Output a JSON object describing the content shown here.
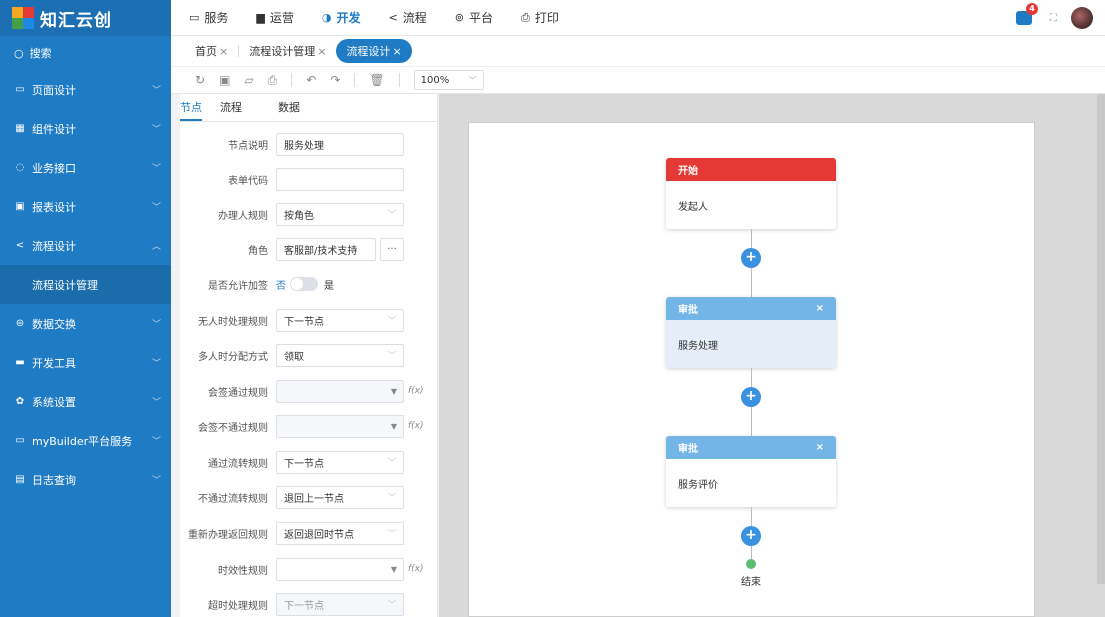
{
  "brand": {
    "name": "知汇云创",
    "colors": {
      "primary": "#1f7bc4",
      "start_node": "#e53935",
      "approve_node": "#73b5e6",
      "end_node": "#5bbd72",
      "badge": "#e53935"
    }
  },
  "sidebar": {
    "search_label": "搜索",
    "items": [
      {
        "label": "页面设计",
        "icon": "page-icon"
      },
      {
        "label": "组件设计",
        "icon": "grid-icon"
      },
      {
        "label": "业务接口",
        "icon": "interface-icon"
      },
      {
        "label": "报表设计",
        "icon": "report-icon"
      },
      {
        "label": "流程设计",
        "icon": "share-icon"
      },
      {
        "label": "数据交换",
        "icon": "database-icon"
      },
      {
        "label": "开发工具",
        "icon": "tools-icon"
      },
      {
        "label": "系统设置",
        "icon": "gear-icon"
      },
      {
        "label": "myBuilder平台服务",
        "icon": "platform-icon"
      },
      {
        "label": "日志查询",
        "icon": "log-icon"
      }
    ],
    "sub_item": "流程设计管理"
  },
  "topnav": {
    "items": [
      {
        "label": "服务",
        "icon": "service-icon"
      },
      {
        "label": "运营",
        "icon": "ops-icon"
      },
      {
        "label": "开发",
        "icon": "dev-icon"
      },
      {
        "label": "流程",
        "icon": "flow-icon"
      },
      {
        "label": "平台",
        "icon": "platform-icon"
      },
      {
        "label": "打印",
        "icon": "print-icon"
      }
    ],
    "active": "开发",
    "message_count": "4"
  },
  "tabs": [
    {
      "label": "首页",
      "close": "×"
    },
    {
      "label": "流程设计管理",
      "close": "×"
    },
    {
      "label": "流程设计",
      "close": "×"
    }
  ],
  "toolbar": {
    "zoom": "100%"
  },
  "panel": {
    "tabs": [
      "节点",
      "流程",
      "数据"
    ],
    "fields": {
      "node_desc": {
        "label": "节点说明",
        "value": "服务处理"
      },
      "form_code": {
        "label": "表单代码",
        "value": ""
      },
      "handler_rule": {
        "label": "办理人规则",
        "value": "按角色"
      },
      "role": {
        "label": "角色",
        "value": "客服部/技术支持",
        "button": "···"
      },
      "allow_add_sign": {
        "label": "是否允许加签",
        "off_text": "否",
        "on_text": "是"
      },
      "no_one_rule": {
        "label": "无人时处理规则",
        "value": "下一节点"
      },
      "multi_assign": {
        "label": "多人时分配方式",
        "value": "领取"
      },
      "countersign_pass": {
        "label": "会签通过规则",
        "value": "",
        "fx": "f(x)"
      },
      "countersign_fail": {
        "label": "会签不通过规则",
        "value": "",
        "fx": "f(x)"
      },
      "pass_flow": {
        "label": "通过流转规则",
        "value": "下一节点"
      },
      "fail_flow": {
        "label": "不通过流转规则",
        "value": "退回上一节点"
      },
      "redo_return": {
        "label": "重新办理返回规则",
        "value": "返回退回时节点"
      },
      "timeliness": {
        "label": "时效性规则",
        "value": "",
        "fx": "f(x)"
      },
      "timeout": {
        "label": "超时处理规则",
        "value": "下一节点"
      }
    }
  },
  "flow": {
    "nodes": [
      {
        "title": "开始",
        "body": "发起人",
        "type": "start"
      },
      {
        "title": "审批",
        "body": "服务处理",
        "type": "approve",
        "close": "×"
      },
      {
        "title": "审批",
        "body": "服务评价",
        "type": "approve",
        "close": "×"
      }
    ],
    "add": "+",
    "end_label": "结束"
  }
}
